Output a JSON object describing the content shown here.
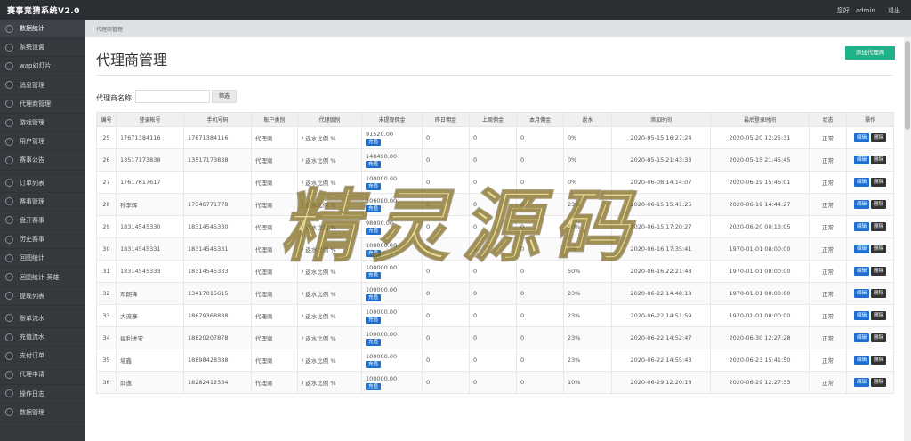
{
  "app": {
    "brand": "赛事竞猜系统V2.0"
  },
  "topbar": {
    "greeting": "您好，admin",
    "logout": "退出"
  },
  "sidebar": {
    "items": [
      {
        "label": "数据统计",
        "active": true
      },
      {
        "label": "系统设置"
      },
      {
        "label": "wap幻灯片"
      },
      {
        "label": "消息管理"
      },
      {
        "label": "代理商管理"
      },
      {
        "label": "游戏管理"
      },
      {
        "label": "用户管理"
      },
      {
        "label": "赛事公告"
      },
      {
        "label": "订单列表"
      },
      {
        "label": "赛事管理"
      },
      {
        "label": "盘开赛事"
      },
      {
        "label": "历史赛事"
      },
      {
        "label": "回图统计"
      },
      {
        "label": "回图统计-英雄"
      },
      {
        "label": "提现列表"
      },
      {
        "label": "账单流水"
      },
      {
        "label": "充值流水"
      },
      {
        "label": "支付订单"
      },
      {
        "label": "代理申请"
      },
      {
        "label": "操作日志"
      },
      {
        "label": "数据管理"
      }
    ]
  },
  "breadcrumb": {
    "text": "代理商管理"
  },
  "page": {
    "title": "代理商管理",
    "add_button": "添加代理商"
  },
  "filter": {
    "label": "代理商名称:",
    "value": "",
    "placeholder": "",
    "button": "筛选"
  },
  "table": {
    "headers": [
      "编号",
      "登录帐号",
      "手机号码",
      "账户类别",
      "代理级别",
      "未提现佣金",
      "昨日佣金",
      "上周佣金",
      "本月佣金",
      "返水",
      "添加时间",
      "最后登录时间",
      "状态",
      "操作"
    ],
    "recharge_label": "充值",
    "edit_label": "编辑",
    "delete_label": "删除",
    "rows": [
      {
        "id": "25",
        "account": "17671384116",
        "phone": "17671384116",
        "type": "代理商",
        "level": "/ 返水比例 %",
        "balance": "91520.00",
        "yesterday": "0",
        "last_week": "0",
        "this_month": "0",
        "rebate": "0%",
        "added": "2020-05-15 16:27:24",
        "last_login": "2020-05-20 12:25:31",
        "status": "正常"
      },
      {
        "id": "26",
        "account": "13517173838",
        "phone": "13517173838",
        "type": "代理商",
        "level": "/ 返水比例 %",
        "balance": "148490.00",
        "yesterday": "0",
        "last_week": "0",
        "this_month": "0",
        "rebate": "0%",
        "added": "2020-05-15 21:43:33",
        "last_login": "2020-05-15 21:45:45",
        "status": "正常"
      },
      {
        "id": "27",
        "account": "17617617617",
        "phone": "",
        "type": "代理商",
        "level": "/ 返水比例 %",
        "balance": "100000.00",
        "yesterday": "0",
        "last_week": "0",
        "this_month": "0",
        "rebate": "0%",
        "added": "2020-06-08 14:14:07",
        "last_login": "2020-06-19 15:46:01",
        "status": "正常"
      },
      {
        "id": "28",
        "account": "孙李辉",
        "phone": "17346771778",
        "type": "代理商",
        "level": "/ 返水比例 %",
        "balance": "106080.00",
        "yesterday": "0",
        "last_week": "0",
        "this_month": "0",
        "rebate": "23%",
        "added": "2020-06-15 15:41:25",
        "last_login": "2020-06-19 14:44:27",
        "status": "正常"
      },
      {
        "id": "29",
        "account": "18314545330",
        "phone": "18314545330",
        "type": "代理商",
        "level": "/ 返水比例 %",
        "balance": "98000.00",
        "yesterday": "0",
        "last_week": "0",
        "this_month": "0",
        "rebate": "50%",
        "added": "2020-06-15 17:20:27",
        "last_login": "2020-06-20 00:13:05",
        "status": "正常"
      },
      {
        "id": "30",
        "account": "18314545331",
        "phone": "18314545331",
        "type": "代理商",
        "level": "/ 返水比例 %",
        "balance": "100000.00",
        "yesterday": "0",
        "last_week": "0",
        "this_month": "0",
        "rebate": "0%",
        "added": "2020-06-16 17:35:41",
        "last_login": "1970-01-01 08:00:00",
        "status": "正常"
      },
      {
        "id": "31",
        "account": "18314545333",
        "phone": "18314545333",
        "type": "代理商",
        "level": "/ 返水比例 %",
        "balance": "100000.00",
        "yesterday": "0",
        "last_week": "0",
        "this_month": "0",
        "rebate": "50%",
        "added": "2020-06-16 22:21:48",
        "last_login": "1970-01-01 08:00:00",
        "status": "正常"
      },
      {
        "id": "32",
        "account": "邓朗锋",
        "phone": "13417015615",
        "type": "代理商",
        "level": "/ 返水比例 %",
        "balance": "100000.00",
        "yesterday": "0",
        "last_week": "0",
        "this_month": "0",
        "rebate": "23%",
        "added": "2020-06-22 14:48:18",
        "last_login": "1970-01-01 08:00:00",
        "status": "正常"
      },
      {
        "id": "33",
        "account": "大流寨",
        "phone": "18679368888",
        "type": "代理商",
        "level": "/ 返水比例 %",
        "balance": "100000.00",
        "yesterday": "0",
        "last_week": "0",
        "this_month": "0",
        "rebate": "23%",
        "added": "2020-06-22 14:51:59",
        "last_login": "1970-01-01 08:00:00",
        "status": "正常"
      },
      {
        "id": "34",
        "account": "福利进宝",
        "phone": "18820207878",
        "type": "代理商",
        "level": "/ 返水比例 %",
        "balance": "100000.00",
        "yesterday": "0",
        "last_week": "0",
        "this_month": "0",
        "rebate": "23%",
        "added": "2020-06-22 14:52:47",
        "last_login": "2020-06-30 12:27:28",
        "status": "正常"
      },
      {
        "id": "35",
        "account": "墙鑫",
        "phone": "18898428388",
        "type": "代理商",
        "level": "/ 返水比例 %",
        "balance": "100000.00",
        "yesterday": "0",
        "last_week": "0",
        "this_month": "0",
        "rebate": "23%",
        "added": "2020-06-22 14:55:43",
        "last_login": "2020-06-23 15:41:50",
        "status": "正常"
      },
      {
        "id": "36",
        "account": "邱逸",
        "phone": "18282412534",
        "type": "代理商",
        "level": "/ 返水比例 %",
        "balance": "100000.00",
        "yesterday": "0",
        "last_week": "0",
        "this_month": "0",
        "rebate": "10%",
        "added": "2020-06-29 12:20:18",
        "last_login": "2020-06-29 12:27:33",
        "status": "正常"
      }
    ]
  },
  "watermark": {
    "text": "精灵源码"
  },
  "colors": {
    "sidebar": "#35393e",
    "topbar": "#2b2e33",
    "accent_green": "#1fb187",
    "button_blue": "#1e6fd0",
    "delete_dark": "#333333"
  }
}
